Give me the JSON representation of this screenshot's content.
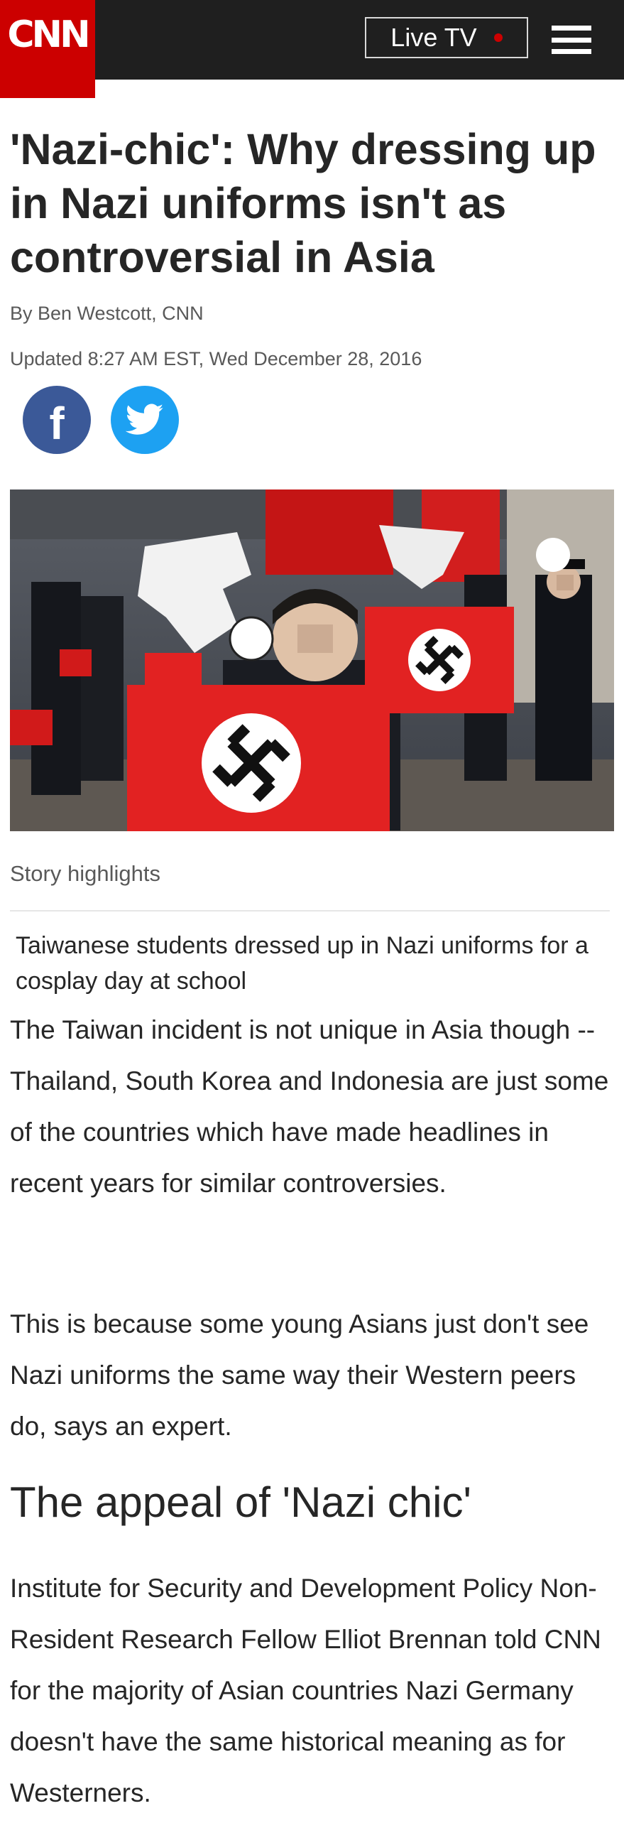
{
  "header": {
    "logo_text": "CNN",
    "live_tv_label": "Live TV",
    "accent_color": "#cc0000",
    "bar_color": "#1f1f1f"
  },
  "article": {
    "headline": "'Nazi-chic': Why dressing up in Nazi uniforms isn't as controversial in Asia",
    "byline": "By Ben Westcott, CNN",
    "updated": "Updated 8:27 AM EST, Wed December 28, 2016",
    "share": {
      "facebook_icon": "facebook-icon",
      "twitter_icon": "twitter-icon",
      "facebook_color": "#3b5998",
      "twitter_color": "#1da1f2"
    },
    "image": {
      "subject": "students in Nazi-style uniforms holding red flags"
    },
    "highlights_title": "Story highlights",
    "highlights": [
      "Taiwanese students dressed up in Nazi uniforms for a cosplay day at school"
    ],
    "paragraphs": [
      "The Taiwan incident is not unique in Asia though -- Thailand, South Korea and Indonesia are just some of the countries which have made headlines in recent years for similar controversies.",
      "This is because some young Asians just don't see Nazi uniforms the same way their Western peers do, says an expert."
    ],
    "subhead": "The appeal of 'Nazi chic'",
    "paragraphs_after": [
      "Institute for Security and Development Policy Non-Resident Research Fellow Elliot Brennan told CNN for the majority of Asian countries Nazi Germany doesn't have the same historical meaning as for Westerners."
    ]
  }
}
